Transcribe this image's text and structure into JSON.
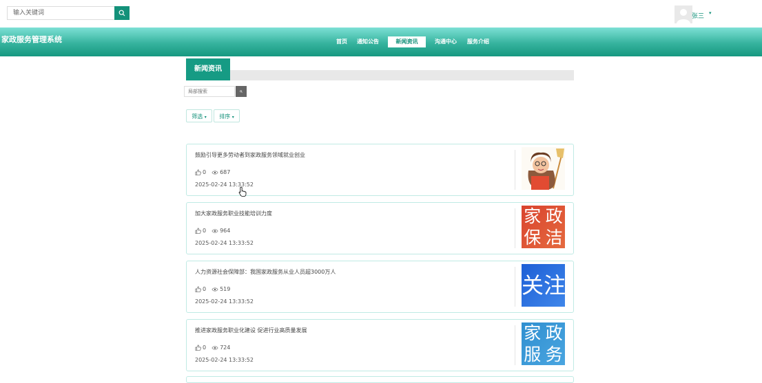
{
  "header": {
    "search_placeholder": "输入关键词",
    "user_name": "张三",
    "user_caret": "▾"
  },
  "nav": {
    "site_title": "家政服务管理系统",
    "items": [
      {
        "label": "首页",
        "active": false
      },
      {
        "label": "通知公告",
        "active": false
      },
      {
        "label": "新闻资讯",
        "active": true
      },
      {
        "label": "沟通中心",
        "active": false
      },
      {
        "label": "服务介绍",
        "active": false
      }
    ]
  },
  "section": {
    "title": "新闻资讯",
    "local_search_placeholder": "局部搜索",
    "filter_label": "筛选",
    "sort_label": "排序",
    "caret": "▾"
  },
  "news": [
    {
      "title": "鼓励引导更多劳动者到家政服务领域就业创业",
      "likes": "0",
      "views": "687",
      "date": "2025-02-24 13:33:52",
      "thumb": "worker-illustration"
    },
    {
      "title": "加大家政服务职业技能培训力度",
      "likes": "0",
      "views": "964",
      "date": "2025-02-24 13:33:52",
      "thumb": "text-tile",
      "thumb_text": [
        "家",
        "政",
        "保",
        "洁"
      ],
      "thumb_colors": [
        "#d9432d",
        "#e56a3f"
      ]
    },
    {
      "title": "人力资源社会保障部：我国家政服务从业人员超3000万人",
      "likes": "0",
      "views": "519",
      "date": "2025-02-24 13:33:52",
      "thumb": "text-tile",
      "thumb_text": [
        "关",
        "注"
      ],
      "thumb_colors": [
        "#1d5fd6",
        "#3f86ea"
      ]
    },
    {
      "title": "推进家政服务职业化建设 促进行业高质量发展",
      "likes": "0",
      "views": "724",
      "date": "2025-02-24 13:33:52",
      "thumb": "text-tile",
      "thumb_text": [
        "家",
        "政",
        "服",
        "务"
      ],
      "thumb_colors": [
        "#2f8fd0",
        "#4aa5e0"
      ]
    }
  ],
  "colors": {
    "accent": "#13917a",
    "nav_top": "#7de0d5",
    "nav_bottom": "#169880"
  }
}
